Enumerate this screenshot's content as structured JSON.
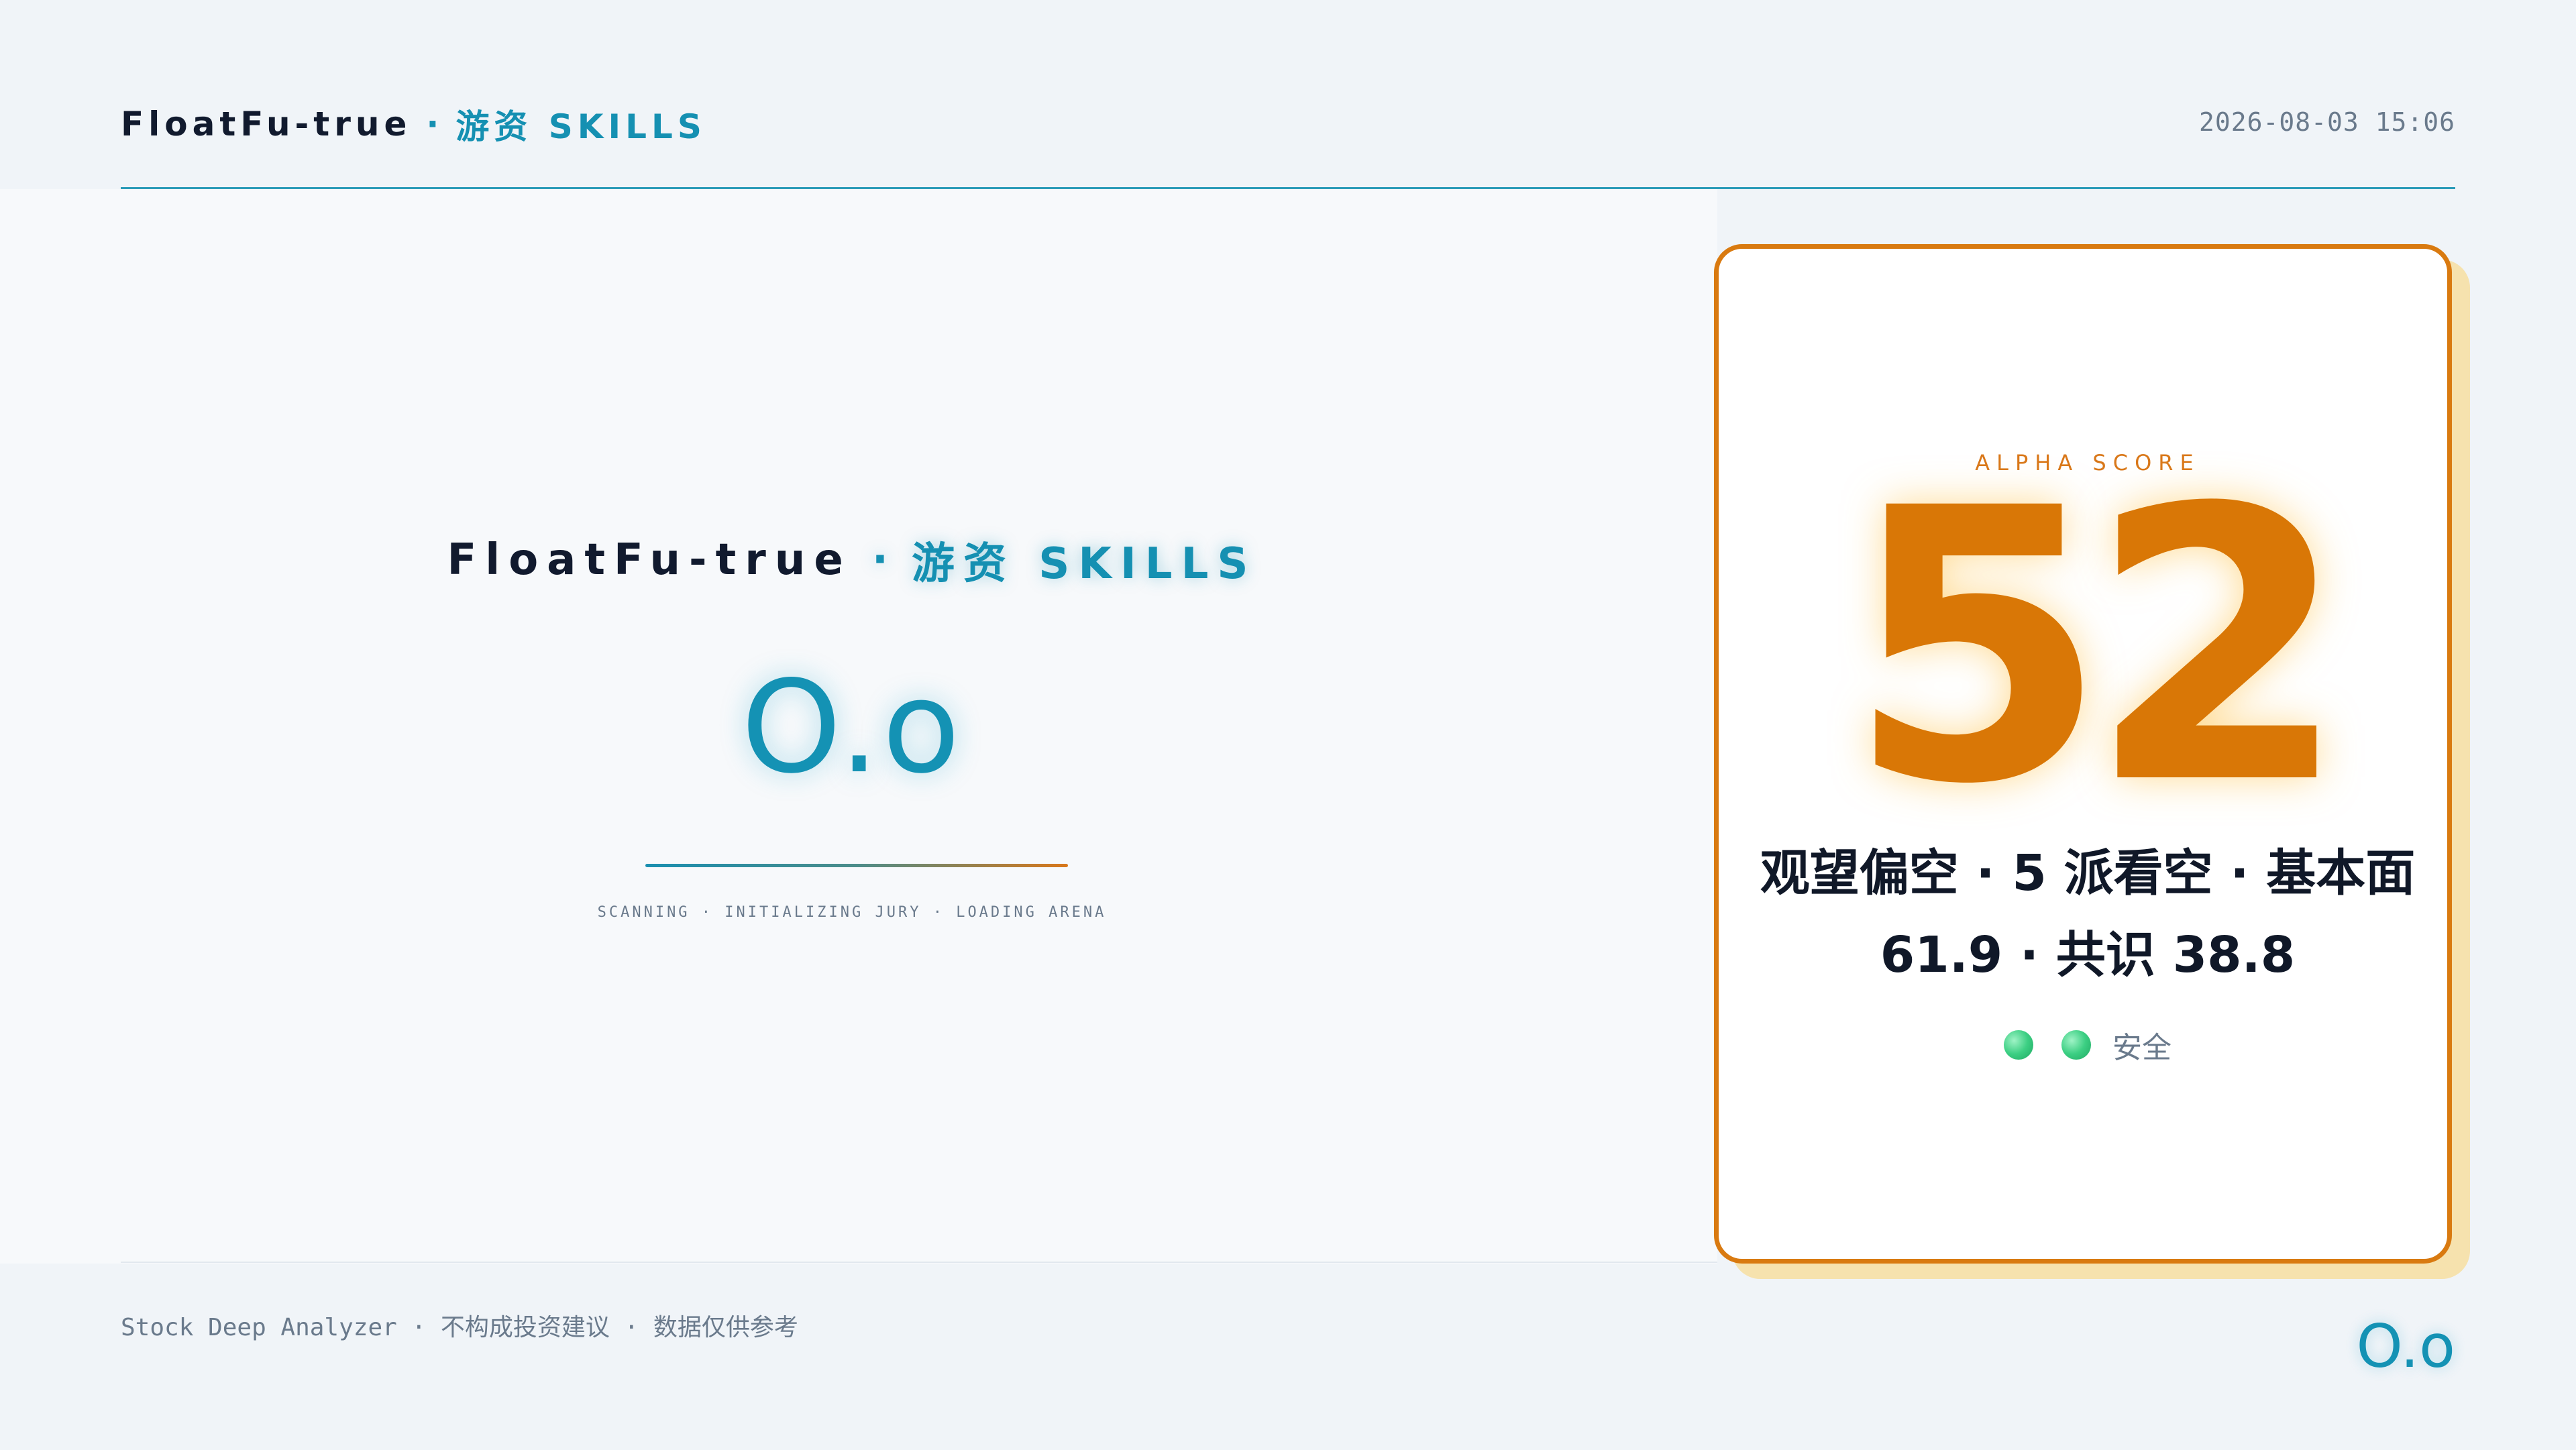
{
  "header": {
    "brand_name": "FloatFu-true",
    "brand_separator": "·",
    "brand_suffix": "游资 SKILLS",
    "timestamp": "2026-08-03 15:06"
  },
  "splash": {
    "title_name": "FloatFu-true",
    "title_separator": "·",
    "title_suffix": "游资 SKILLS",
    "logo_text": "O.o",
    "status_text": "SCANNING · INITIALIZING JURY · LOADING ARENA"
  },
  "score_card": {
    "label": "ALPHA SCORE",
    "score": "52",
    "summary_line1": "观望偏空 · 5 派看空 · 基本面",
    "summary_line2": "61.9 · 共识 38.8",
    "status_label": "安全",
    "status_dot_count": 2,
    "status_color": "#3ccf83",
    "accent_color": "#d97706"
  },
  "footer": {
    "disclaimer": "Stock Deep Analyzer · 不构成投资建议 · 数据仅供参考",
    "logo_text": "O.o"
  },
  "colors": {
    "brand_teal": "#1590b2",
    "text_dark": "#111a2e",
    "text_muted": "#6a7a8c",
    "card_border": "#d97a10",
    "card_shadow": "#f6e2ae"
  }
}
